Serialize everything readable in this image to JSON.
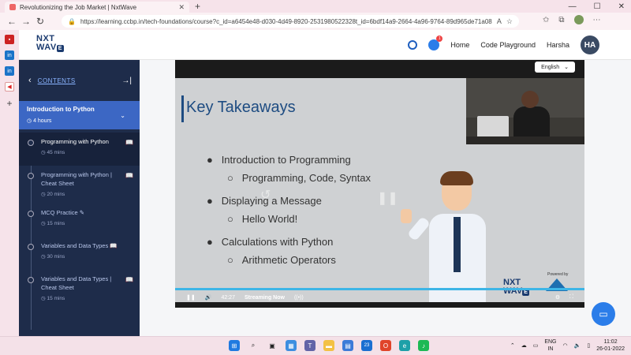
{
  "browser": {
    "tab_title": "Revolutionizing the Job Market | NxtWave",
    "url": "https://learning.ccbp.in/tech-foundations/course?c_id=a6454e48-d030-4d49-8920-2531980522328t_id=6bdf14a9-2664-4a96-9764-89d965de71a08s_id=426c0498-accc-4..."
  },
  "header": {
    "logo_top": "NXT",
    "logo_bottom": "WAV",
    "logo_badge": "E",
    "notification_count": "1",
    "home_label": "Home",
    "playground_label": "Code Playground",
    "user_name": "Harsha",
    "avatar_initials": "HA"
  },
  "sidebar": {
    "contents_label": "CONTENTS",
    "module_title": "Introduction to Python",
    "module_duration": "4 hours",
    "lessons": [
      {
        "title": "Programming with Python",
        "duration": "45 mins",
        "icon": "book-icon"
      },
      {
        "title": "Programming with Python | Cheat Sheet",
        "duration": "20 mins",
        "icon": "book-icon"
      },
      {
        "title": "MCQ Practice",
        "duration": "15 mins",
        "icon": "pencil-icon"
      },
      {
        "title": "Variables and Data Types",
        "duration": "30 mins",
        "icon": "book-icon"
      },
      {
        "title": "Variables and Data Types | Cheat Sheet",
        "duration": "15 mins",
        "icon": "book-icon"
      }
    ]
  },
  "video": {
    "language": "English",
    "slide_title": "Key Takeaways",
    "bullets": [
      "Introduction to Programming",
      "Programming, Code, Syntax",
      "Displaying a Message",
      "Hello World!",
      "Calculations with Python",
      "Arithmetic Operators"
    ],
    "watermark_top": "NXT",
    "watermark_bottom": "WAV",
    "watermark_badge": "E",
    "powered_by": "Powered by",
    "time": "42:27",
    "stream_label": "Streaming Now"
  },
  "taskbar": {
    "badge_count": "23",
    "lang_top": "ENG",
    "lang_bottom": "IN",
    "time": "11:02",
    "date": "26-01-2022"
  },
  "colors": {
    "sidebar_bg": "#1e2c4a",
    "module_bg": "#3c67c4",
    "accent": "#2b7de9",
    "slide_heading": "#1e4c82"
  }
}
